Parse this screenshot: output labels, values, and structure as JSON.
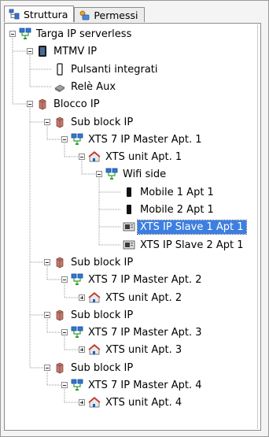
{
  "tabs": [
    {
      "label": "Struttura",
      "icon": "structure-icon"
    },
    {
      "label": "Permessi",
      "icon": "permissions-icon"
    }
  ],
  "tree": [
    {
      "label": "Targa IP serverless",
      "icon": "network-icon",
      "toggle": "minus"
    },
    {
      "label": "MTMV IP",
      "icon": "monitor-icon",
      "toggle": "minus"
    },
    {
      "label": "Pulsanti integrati",
      "icon": "phone-icon"
    },
    {
      "label": "Relè Aux",
      "icon": "relay-icon"
    },
    {
      "label": "Blocco IP",
      "icon": "block-icon",
      "toggle": "minus"
    },
    {
      "label": "Sub block IP",
      "icon": "block-icon",
      "toggle": "minus"
    },
    {
      "label": "XTS 7 IP Master Apt. 1",
      "icon": "network-icon",
      "toggle": "minus"
    },
    {
      "label": "XTS unit Apt. 1",
      "icon": "house-icon",
      "toggle": "minus"
    },
    {
      "label": "Wifi side",
      "icon": "network-icon",
      "toggle": "minus"
    },
    {
      "label": "Mobile 1 Apt 1",
      "icon": "mobile-icon"
    },
    {
      "label": "Mobile 2 Apt 1",
      "icon": "mobile-icon"
    },
    {
      "label": "XTS IP Slave 1 Apt 1",
      "icon": "slave-icon",
      "selected": true
    },
    {
      "label": "XTS IP Slave 2 Apt 1",
      "icon": "slave-icon"
    },
    {
      "label": "Sub block IP",
      "icon": "block-icon",
      "toggle": "minus"
    },
    {
      "label": "XTS 7 IP Master Apt. 2",
      "icon": "network-icon",
      "toggle": "minus"
    },
    {
      "label": "XTS unit Apt. 2",
      "icon": "house-icon",
      "toggle": "plus"
    },
    {
      "label": "Sub block IP",
      "icon": "block-icon",
      "toggle": "minus"
    },
    {
      "label": "XTS 7 IP Master Apt. 3",
      "icon": "network-icon",
      "toggle": "minus"
    },
    {
      "label": "XTS unit Apt. 3",
      "icon": "house-icon",
      "toggle": "plus"
    },
    {
      "label": "Sub block IP",
      "icon": "block-icon",
      "toggle": "minus"
    },
    {
      "label": "XTS 7 IP Master Apt. 4",
      "icon": "network-icon",
      "toggle": "minus"
    },
    {
      "label": "XTS unit Apt. 4",
      "icon": "house-icon",
      "toggle": "plus"
    }
  ]
}
